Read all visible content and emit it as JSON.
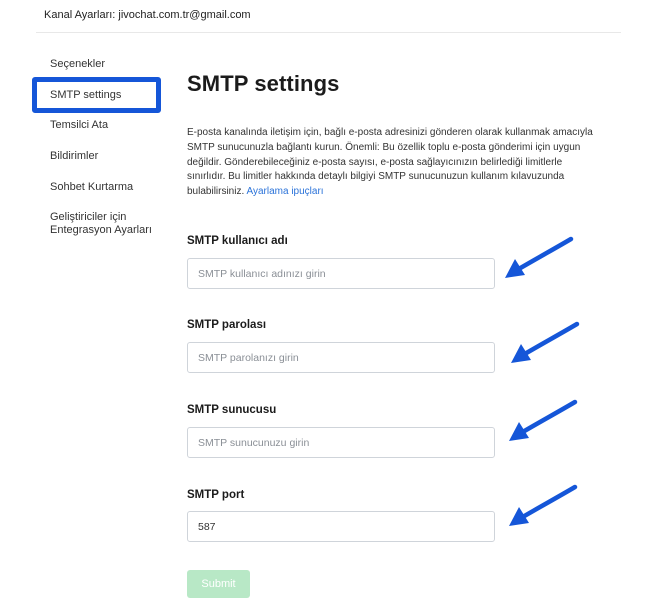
{
  "header": {
    "title": "Kanal Ayarları: jivochat.com.tr@gmail.com"
  },
  "sidebar": {
    "items": [
      {
        "label": "Seçenekler"
      },
      {
        "label": "SMTP settings",
        "active": true
      },
      {
        "label": "Temsilci Ata"
      },
      {
        "label": "Bildirimler"
      },
      {
        "label": "Sohbet Kurtarma"
      },
      {
        "label": "Geliştiriciler için Entegrasyon Ayarları"
      }
    ]
  },
  "main": {
    "title": "SMTP settings",
    "description": "E-posta kanalında iletişim için, bağlı e-posta adresinizi gönderen olarak kullanmak amacıyla SMTP sunucunuzla bağlantı kurun. Önemli: Bu özellik toplu e-posta gönderimi için uygun değildir. Gönderebileceğiniz e-posta sayısı, e-posta sağlayıcınızın belirlediği limitlerle sınırlıdır. Bu limitler hakkında detaylı bilgiyi SMTP sunucunuzun kullanım kılavuzunda bulabilirsiniz.",
    "help_link": "Ayarlama ipuçları",
    "fields": [
      {
        "label": "SMTP kullanıcı adı",
        "placeholder": "SMTP kullanıcı adınızı girin",
        "value": ""
      },
      {
        "label": "SMTP parolası",
        "placeholder": "SMTP parolanızı girin",
        "value": ""
      },
      {
        "label": "SMTP sunucusu",
        "placeholder": "SMTP sunucunuzu girin",
        "value": ""
      },
      {
        "label": "SMTP port",
        "placeholder": "",
        "value": "587"
      }
    ],
    "submit_label": "Submit"
  },
  "colors": {
    "highlight_box": "#1556d8",
    "annotation_arrow": "#1556d8",
    "link": "#2b73d9",
    "submit_bg": "#b8e8c6"
  },
  "icons": {
    "annotation": "arrow-pointer-icon"
  }
}
